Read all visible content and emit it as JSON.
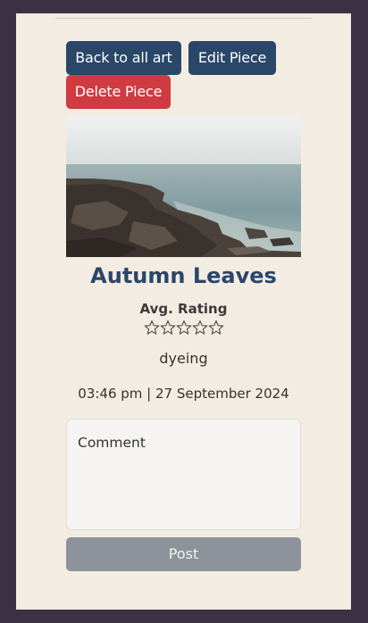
{
  "actions": {
    "back_label": "Back to all art",
    "edit_label": "Edit Piece",
    "delete_label": "Delete Piece"
  },
  "piece": {
    "title": "Autumn Leaves",
    "rating_label": "Avg. Rating",
    "rating_value": 0,
    "rating_max": 5,
    "technique": "dyeing",
    "datetime": "03:46 pm | 27 September 2024"
  },
  "comment_form": {
    "placeholder": "Comment",
    "post_label": "Post"
  },
  "colors": {
    "primary": "#2a4668",
    "danger": "#cf3b40",
    "disabled": "#8d939a",
    "card_bg": "#f3ece2",
    "page_bg": "#3a3143"
  },
  "icons": {
    "star": "star-outline-icon"
  }
}
